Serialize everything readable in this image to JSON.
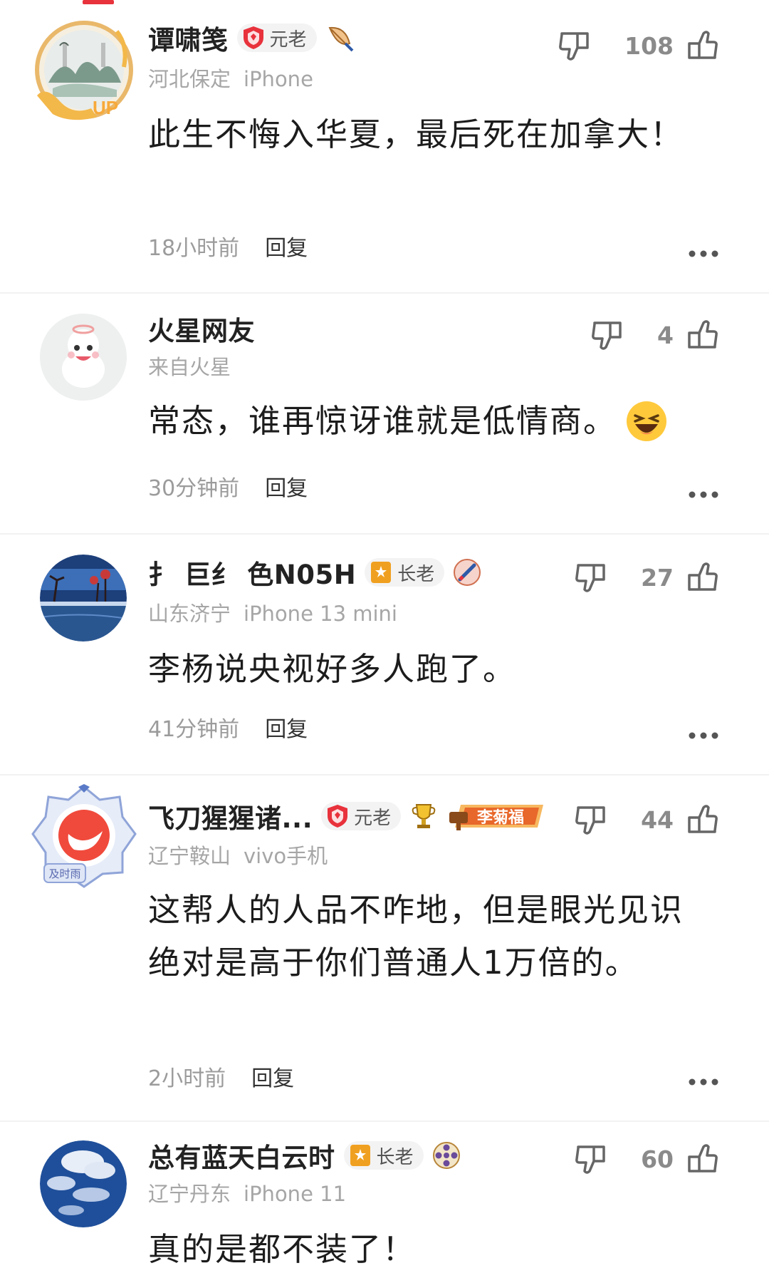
{
  "comments": [
    {
      "username": "谭啸笺",
      "badge": "元老",
      "location": "河北保定",
      "device": "iPhone",
      "text": "此生不悔入华夏，最后死在加拿大！",
      "time": "18小时前",
      "reply": "回复",
      "likes": "108",
      "avatar_text": "UP"
    },
    {
      "username": "火星网友",
      "badge": "",
      "location": "来自火星",
      "device": "",
      "text": "常态，谁再惊讶谁就是低情商。",
      "time": "30分钟前",
      "reply": "回复",
      "likes": "4"
    },
    {
      "username": "扌 巨纟 色N05H",
      "badge": "长老",
      "location": "山东济宁",
      "device": "iPhone 13 mini",
      "text": "李杨说央视好多人跑了。",
      "time": "41分钟前",
      "reply": "回复",
      "likes": "27"
    },
    {
      "username": "飞刀猩猩诸...",
      "badge": "元老",
      "location": "辽宁鞍山",
      "device": "vivo手机",
      "text": "这帮人的人品不咋地，但是眼光见识绝对是高于你们普通人1万倍的。",
      "time": "2小时前",
      "reply": "回复",
      "likes": "44",
      "avatar_text": "及时雨",
      "medal_text": "李菊福"
    },
    {
      "username": "总有蓝天白云时",
      "badge": "长老",
      "location": "辽宁丹东",
      "device": "iPhone 11",
      "text": "真的是都不装了！",
      "time": "",
      "reply": "",
      "likes": "60"
    }
  ],
  "icons": {
    "like": "thumb-up-icon",
    "dislike": "thumb-down-icon",
    "more": "more-dots-icon",
    "laugh_emoji": "laughing-emoji-icon"
  },
  "colors": {
    "accent": "#e8323c",
    "meta": "#a6a6a6",
    "badge_red": "#e8323c",
    "badge_orange": "#f0a020"
  }
}
